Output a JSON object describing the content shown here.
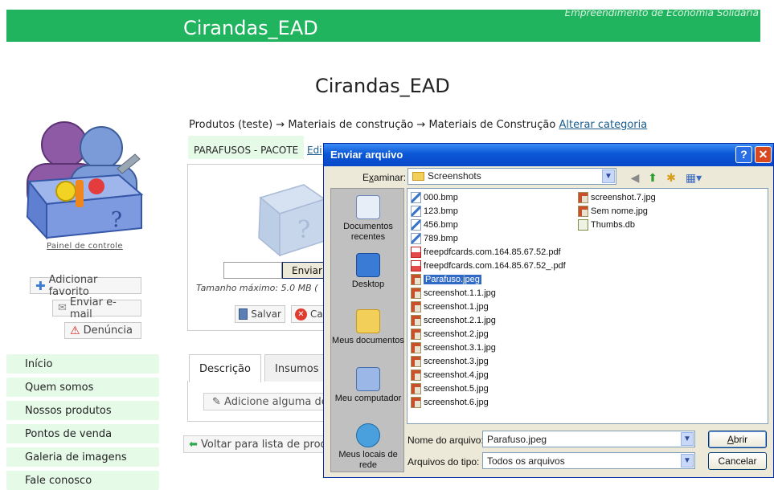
{
  "site": {
    "title": "Cirandas_EAD",
    "tagline": "Empreendimento de Economia Solidária",
    "heading": "Cirandas_EAD"
  },
  "sidebar": {
    "panel_link": "Painel de controle",
    "actions": {
      "favorite": "Adicionar favorito",
      "email": "Enviar e-mail",
      "report": "Denúncia"
    },
    "nav": [
      "Início",
      "Quem somos",
      "Nossos produtos",
      "Pontos de venda",
      "Galeria de imagens",
      "Fale conosco"
    ]
  },
  "main": {
    "breadcrumb": "Produtos (teste) → Materiais de construção → Materiais de Construção",
    "change_category": "Alterar categoria",
    "product_name": "PARAFUSOS - PACOTE",
    "edit_link": "Edi",
    "send_button": "Enviar",
    "max_size": "Tamanho máximo: 5.0 MB (",
    "save_button": "Salvar",
    "cancel_button": "Ca",
    "tabs": [
      "Descrição",
      "Insumos"
    ],
    "add_description": "Adicione alguma de",
    "back_button": "Voltar para lista de prod"
  },
  "dialog": {
    "title": "Enviar arquivo",
    "look_in_label": "Examinar:",
    "look_in_value": "Screenshots",
    "places": [
      "Documentos recentes",
      "Desktop",
      "Meus documentos",
      "Meu computador",
      "Meus locais de rede"
    ],
    "files": [
      {
        "name": "000.bmp",
        "type": "bmp"
      },
      {
        "name": "123.bmp",
        "type": "bmp"
      },
      {
        "name": "456.bmp",
        "type": "bmp"
      },
      {
        "name": "789.bmp",
        "type": "bmp"
      },
      {
        "name": "freepdfcards.com.164.85.67.52.pdf",
        "type": "pdf"
      },
      {
        "name": "freepdfcards.com.164.85.67.52_.pdf",
        "type": "pdf"
      },
      {
        "name": "Parafuso.jpeg",
        "type": "jpg",
        "selected": true
      },
      {
        "name": "screenshot.1.1.jpg",
        "type": "jpg"
      },
      {
        "name": "screenshot.1.jpg",
        "type": "jpg"
      },
      {
        "name": "screenshot.2.1.jpg",
        "type": "jpg"
      },
      {
        "name": "screenshot.2.jpg",
        "type": "jpg"
      },
      {
        "name": "screenshot.3.1.jpg",
        "type": "jpg"
      },
      {
        "name": "screenshot.3.jpg",
        "type": "jpg"
      },
      {
        "name": "screenshot.4.jpg",
        "type": "jpg"
      },
      {
        "name": "screenshot.5.jpg",
        "type": "jpg"
      },
      {
        "name": "screenshot.6.jpg",
        "type": "jpg"
      },
      {
        "name": "screenshot.7.jpg",
        "type": "jpg"
      },
      {
        "name": "Sem nome.jpg",
        "type": "jpg"
      },
      {
        "name": "Thumbs.db",
        "type": "db"
      }
    ],
    "filename_label": "Nome do arquivo:",
    "filename_value": "Parafuso.jpeg",
    "filetype_label": "Arquivos do tipo:",
    "filetype_value": "Todos os arquivos",
    "open_button": "Abrir",
    "cancel_button": "Cancelar"
  },
  "colors": {
    "header_green": "#21b45f",
    "nav_bg": "#e6fae8",
    "xp_title_blue": "#0a57d6",
    "selection_blue": "#316ac5"
  }
}
